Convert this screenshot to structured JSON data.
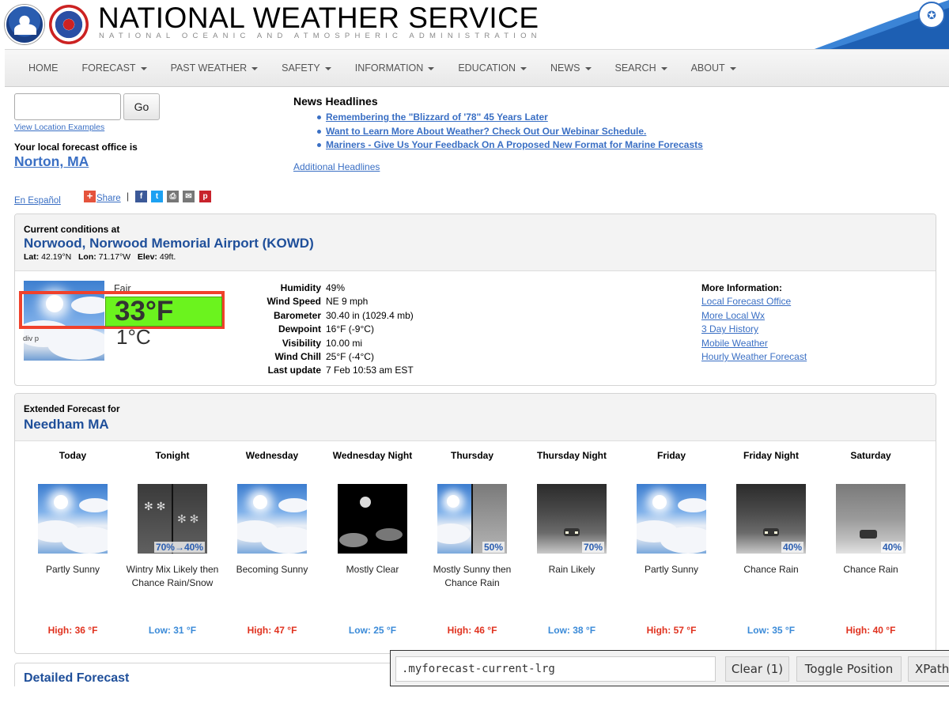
{
  "header": {
    "title": "NATIONAL WEATHER SERVICE",
    "subtitle": "NATIONAL OCEANIC AND ATMOSPHERIC ADMINISTRATION",
    "noaa_logo_text": "NOAA",
    "brand_color": "#2a5db0"
  },
  "nav": {
    "items": [
      {
        "label": "HOME",
        "dropdown": false
      },
      {
        "label": "FORECAST",
        "dropdown": true
      },
      {
        "label": "PAST WEATHER",
        "dropdown": true
      },
      {
        "label": "SAFETY",
        "dropdown": true
      },
      {
        "label": "INFORMATION",
        "dropdown": true
      },
      {
        "label": "EDUCATION",
        "dropdown": true
      },
      {
        "label": "NEWS",
        "dropdown": true
      },
      {
        "label": "SEARCH",
        "dropdown": true
      },
      {
        "label": "ABOUT",
        "dropdown": true
      }
    ]
  },
  "search": {
    "value": "",
    "button": "Go",
    "examples_link": "View Location Examples"
  },
  "local_office": {
    "label": "Your local forecast office is",
    "name": "Norton, MA"
  },
  "social": {
    "espanol": "En Español",
    "share": "Share",
    "separator": "|",
    "icons": [
      "facebook-icon",
      "twitter-icon",
      "print-icon",
      "email-icon",
      "pinterest-icon"
    ]
  },
  "news": {
    "title": "News Headlines",
    "items": [
      "Remembering the \"Blizzard of '78\" 45 Years Later",
      "Want to Learn More About Weather? Check Out Our Webinar Schedule.",
      "Mariners - Give Us Your Feedback On A Proposed New Format for Marine Forecasts"
    ],
    "additional": "Additional Headlines"
  },
  "current": {
    "label": "Current conditions at",
    "station": "Norwood, Norwood Memorial Airport (KOWD)",
    "lat_label": "Lat:",
    "lat": "42.19°N",
    "lon_label": "Lon:",
    "lon": "71.17°W",
    "elev_label": "Elev:",
    "elev": "49ft.",
    "summary": "Fair",
    "temp_f": "33°F",
    "temp_c": "1°C",
    "selector_label": "div p",
    "details": [
      {
        "label": "Humidity",
        "value": "49%"
      },
      {
        "label": "Wind Speed",
        "value": "NE 9 mph"
      },
      {
        "label": "Barometer",
        "value": "30.40 in (1029.4 mb)"
      },
      {
        "label": "Dewpoint",
        "value": "16°F (-9°C)"
      },
      {
        "label": "Visibility",
        "value": "10.00 mi"
      },
      {
        "label": "Wind Chill",
        "value": "25°F (-4°C)"
      },
      {
        "label": "Last update",
        "value": "7 Feb 10:53 am EST"
      }
    ],
    "more_info_title": "More Information:",
    "more_links": [
      "Local Forecast Office",
      "More Local Wx",
      "3 Day History",
      "Mobile Weather",
      "Hourly Weather Forecast"
    ]
  },
  "extended": {
    "label": "Extended Forecast for",
    "location": "Needham MA",
    "periods": [
      {
        "name": "Today",
        "short": "Partly Sunny",
        "temp": "High: 36 °F",
        "kind": "hi",
        "pop": "",
        "sky": "sunny"
      },
      {
        "name": "Tonight",
        "short": "Wintry Mix Likely then Chance Rain/Snow",
        "temp": "Low: 31 °F",
        "kind": "lo",
        "pop": "70%→40%",
        "sky": "snow"
      },
      {
        "name": "Wednesday",
        "short": "Becoming Sunny",
        "temp": "High: 47 °F",
        "kind": "hi",
        "pop": "",
        "sky": "sunny"
      },
      {
        "name": "Wednesday Night",
        "short": "Mostly Clear",
        "temp": "Low: 25 °F",
        "kind": "lo",
        "pop": "",
        "sky": "night"
      },
      {
        "name": "Thursday",
        "short": "Mostly Sunny then Chance Rain",
        "temp": "High: 46 °F",
        "kind": "hi",
        "pop": "50%",
        "sky": "sunny-rain"
      },
      {
        "name": "Thursday Night",
        "short": "Rain Likely",
        "temp": "Low: 38 °F",
        "kind": "lo",
        "pop": "70%",
        "sky": "rain"
      },
      {
        "name": "Friday",
        "short": "Partly Sunny",
        "temp": "High: 57 °F",
        "kind": "hi",
        "pop": "",
        "sky": "sunny"
      },
      {
        "name": "Friday Night",
        "short": "Chance Rain",
        "temp": "Low: 35 °F",
        "kind": "lo",
        "pop": "40%",
        "sky": "rain"
      },
      {
        "name": "Saturday",
        "short": "Chance Rain",
        "temp": "High: 40 °F",
        "kind": "hi",
        "pop": "40%",
        "sky": "rain-light"
      }
    ]
  },
  "detailed": {
    "title": "Detailed Forecast"
  },
  "devtool": {
    "selector": ".myforecast-current-lrg",
    "clear": "Clear (1)",
    "toggle": "Toggle Position",
    "xpath": "XPath"
  }
}
